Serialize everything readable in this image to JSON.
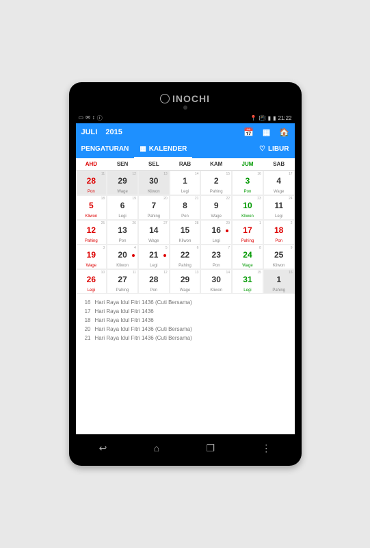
{
  "brand": "INOCHI",
  "statusbar": {
    "time": "21:22"
  },
  "header": {
    "month": "JULI",
    "year": "2015"
  },
  "tabs": {
    "settings": "PENGATURAN",
    "calendar": "KALENDER",
    "holiday": "LIBUR"
  },
  "dayheads": [
    "AHD",
    "SEN",
    "SEL",
    "RAB",
    "KAM",
    "JUM",
    "SAB"
  ],
  "weeks": [
    [
      {
        "hijri": "11",
        "num": "28",
        "pas": "Pon",
        "cls": "sun other",
        "dot": false
      },
      {
        "hijri": "12",
        "num": "29",
        "pas": "Wage",
        "cls": "other",
        "dot": false
      },
      {
        "hijri": "13",
        "num": "30",
        "pas": "Kliwon",
        "cls": "other",
        "dot": false
      },
      {
        "hijri": "14",
        "num": "1",
        "pas": "Legi",
        "cls": "",
        "dot": false
      },
      {
        "hijri": "15",
        "num": "2",
        "pas": "Pahing",
        "cls": "",
        "dot": false
      },
      {
        "hijri": "16",
        "num": "3",
        "pas": "Pon",
        "cls": "fri",
        "dot": false
      },
      {
        "hijri": "17",
        "num": "4",
        "pas": "Wage",
        "cls": "",
        "dot": false
      }
    ],
    [
      {
        "hijri": "18",
        "num": "5",
        "pas": "Kliwon",
        "cls": "sun",
        "dot": false
      },
      {
        "hijri": "19",
        "num": "6",
        "pas": "Legi",
        "cls": "",
        "dot": false
      },
      {
        "hijri": "20",
        "num": "7",
        "pas": "Pahing",
        "cls": "",
        "dot": false
      },
      {
        "hijri": "21",
        "num": "8",
        "pas": "Pon",
        "cls": "",
        "dot": false
      },
      {
        "hijri": "22",
        "num": "9",
        "pas": "Wage",
        "cls": "",
        "dot": false
      },
      {
        "hijri": "23",
        "num": "10",
        "pas": "Kliwon",
        "cls": "fri",
        "dot": false
      },
      {
        "hijri": "24",
        "num": "11",
        "pas": "Legi",
        "cls": "",
        "dot": false
      }
    ],
    [
      {
        "hijri": "25",
        "num": "12",
        "pas": "Pahing",
        "cls": "sun",
        "dot": false
      },
      {
        "hijri": "26",
        "num": "13",
        "pas": "Pon",
        "cls": "",
        "dot": false
      },
      {
        "hijri": "27",
        "num": "14",
        "pas": "Wage",
        "cls": "",
        "dot": false
      },
      {
        "hijri": "28",
        "num": "15",
        "pas": "Kliwon",
        "cls": "",
        "dot": false
      },
      {
        "hijri": "29",
        "num": "16",
        "pas": "Legi",
        "cls": "",
        "dot": true
      },
      {
        "hijri": "1",
        "num": "17",
        "pas": "Pahing",
        "cls": "holiday",
        "dot": false
      },
      {
        "hijri": "2",
        "num": "18",
        "pas": "Pon",
        "cls": "holiday",
        "dot": false
      }
    ],
    [
      {
        "hijri": "3",
        "num": "19",
        "pas": "Wage",
        "cls": "sun",
        "dot": false
      },
      {
        "hijri": "4",
        "num": "20",
        "pas": "Kliwon",
        "cls": "",
        "dot": true
      },
      {
        "hijri": "5",
        "num": "21",
        "pas": "Legi",
        "cls": "",
        "dot": true
      },
      {
        "hijri": "6",
        "num": "22",
        "pas": "Pahing",
        "cls": "",
        "dot": false
      },
      {
        "hijri": "7",
        "num": "23",
        "pas": "Pon",
        "cls": "",
        "dot": false
      },
      {
        "hijri": "8",
        "num": "24",
        "pas": "Wage",
        "cls": "fri",
        "dot": false
      },
      {
        "hijri": "9",
        "num": "25",
        "pas": "Kliwon",
        "cls": "",
        "dot": false
      }
    ],
    [
      {
        "hijri": "10",
        "num": "26",
        "pas": "Legi",
        "cls": "sun",
        "dot": false
      },
      {
        "hijri": "11",
        "num": "27",
        "pas": "Pahing",
        "cls": "",
        "dot": false
      },
      {
        "hijri": "12",
        "num": "28",
        "pas": "Pon",
        "cls": "",
        "dot": false
      },
      {
        "hijri": "13",
        "num": "29",
        "pas": "Wage",
        "cls": "",
        "dot": false
      },
      {
        "hijri": "14",
        "num": "30",
        "pas": "Kliwon",
        "cls": "",
        "dot": false
      },
      {
        "hijri": "15",
        "num": "31",
        "pas": "Legi",
        "cls": "fri",
        "dot": false
      },
      {
        "hijri": "16",
        "num": "1",
        "pas": "Pahing",
        "cls": "other",
        "dot": false
      }
    ]
  ],
  "events": [
    {
      "date": "16",
      "text": "Hari Raya Idul Fitri 1436 (Cuti Bersama)"
    },
    {
      "date": "17",
      "text": "Hari Raya Idul Fitri 1436"
    },
    {
      "date": "18",
      "text": "Hari Raya Idul Fitri 1436"
    },
    {
      "date": "20",
      "text": "Hari Raya Idul Fitri 1436 (Cuti Bersama)"
    },
    {
      "date": "21",
      "text": "Hari Raya Idul Fitri 1436 (Cuti Bersama)"
    }
  ]
}
